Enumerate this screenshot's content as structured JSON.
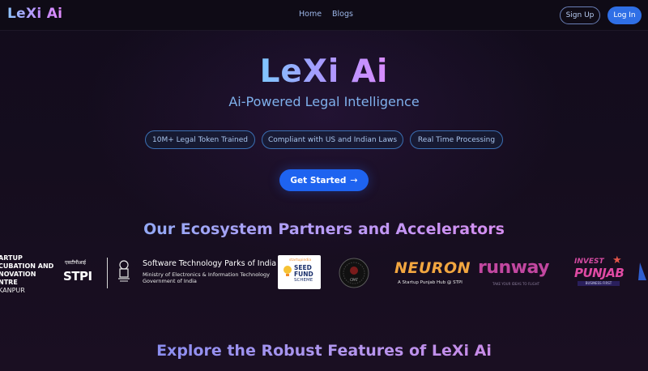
{
  "nav": {
    "logo": "LeXi Ai",
    "links": [
      "Home",
      "Blogs"
    ],
    "signup": "Sign Up",
    "login": "Log In"
  },
  "hero": {
    "title": "LeXi Ai",
    "subtitle": "Ai-Powered Legal Intelligence",
    "pills": [
      "10M+ Legal Token Trained",
      "Compliant with US and Indian Laws",
      "Real Time Processing"
    ],
    "cta": "Get Started",
    "cta_icon": "arrow-right-icon"
  },
  "partners": {
    "title": "Our Ecosystem Partners and Accelerators",
    "startup_centre": {
      "lines": [
        "ARTUP",
        "CUBATION AND",
        "NOVATION",
        "NTRE"
      ],
      "city": "KANPUR"
    },
    "stpi": {
      "hindi": "एसटीपीआई",
      "short": "STPI",
      "name": "Software Technology Parks of India",
      "ministry": "Ministry of Electronics & Information Technology",
      "government": "Government of India"
    },
    "seed_fund": {
      "line1": "SEED",
      "line2": "FUND",
      "line3": "SCHEME",
      "top": "startupindia"
    },
    "seal_text": "CPAT",
    "neuron": {
      "name": "NEURON",
      "tagline": "A Startup Punjab Hub @ STPI"
    },
    "runway": {
      "name": "runway",
      "tagline": "TAKE YOUR IDEAS TO FLIGHT"
    },
    "invest_punjab": {
      "invest": "INVEST",
      "punjab": "PUNJAB",
      "sub": "BUSINESS FIRST"
    }
  },
  "features": {
    "title": "Explore the Robust Features of LeXi Ai"
  }
}
